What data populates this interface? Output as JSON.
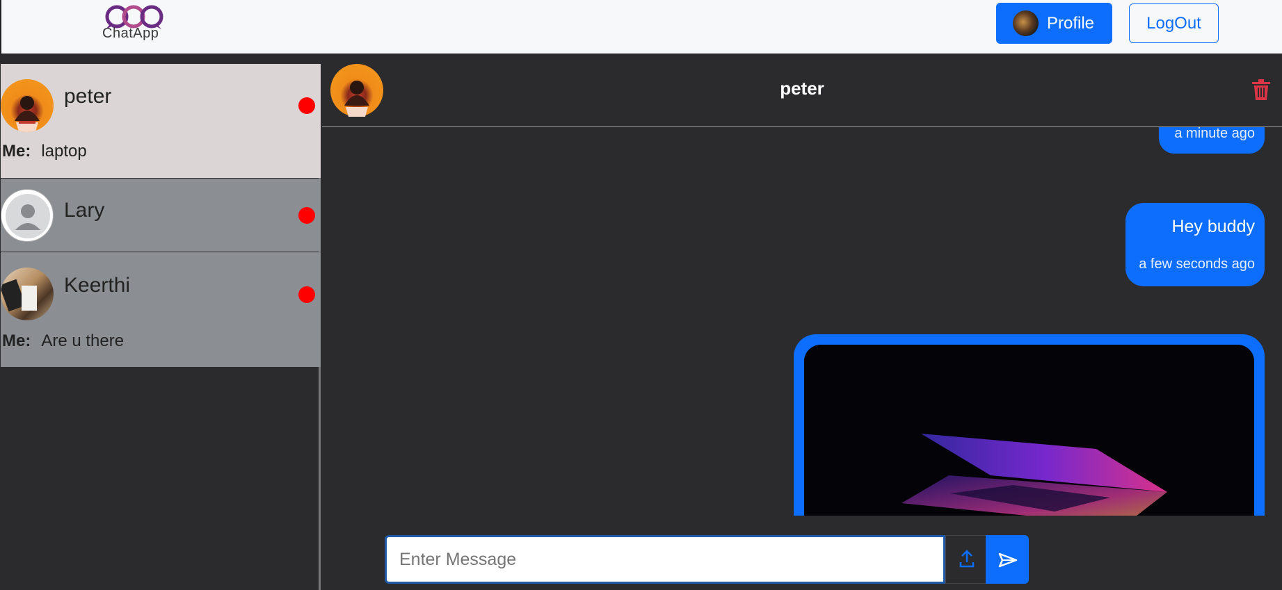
{
  "app": {
    "logo_text": "ChatApp"
  },
  "navbar": {
    "profile_label": "Profile",
    "logout_label": "LogOut"
  },
  "sidebar": {
    "chats": [
      {
        "name": "peter",
        "sender": "Me:",
        "last_message": "laptop",
        "unread": true
      },
      {
        "name": "Lary",
        "unread": true
      },
      {
        "name": "Keerthi",
        "sender": "Me:",
        "last_message": "Are u there",
        "unread": true
      }
    ]
  },
  "chat": {
    "contact_name": "peter",
    "messages": [
      {
        "text": "",
        "time": "a minute ago"
      },
      {
        "text": "Hey buddy",
        "time": "a few seconds ago"
      },
      {
        "image": "laptop-image"
      }
    ]
  },
  "composer": {
    "placeholder": "Enter Message"
  },
  "colors": {
    "primary": "#0d6efd",
    "unread_dot": "#ff0000",
    "background": "#2b2b2e",
    "active_chat": "#dcd5d5",
    "inactive_chat": "#8b8e93"
  },
  "icons": {
    "upload": "upload-icon",
    "send": "send-icon",
    "trash": "trash-icon"
  }
}
